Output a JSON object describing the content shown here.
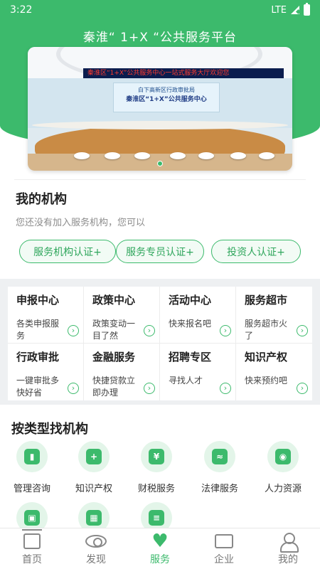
{
  "status_bar": {
    "time": "3:22",
    "network": "LTE"
  },
  "header": {
    "title": "秦淮“ 1+X “公共服务平台"
  },
  "banner": {
    "led_text": "秦淮区“1+X”公共服务中心一站式服务大厅欢迎您",
    "sign_subtitle": "白下高新区行政审批局",
    "sign_title": "秦淮区“1+X”公共服务中心"
  },
  "my_org": {
    "title": "我的机构",
    "hint": "您还没有加入服务机构，您可以",
    "buttons": [
      {
        "label": "服务机构认证+"
      },
      {
        "label": "服务专员认证+"
      },
      {
        "label": "投资人认证+"
      }
    ]
  },
  "services": [
    {
      "title": "申报中心",
      "desc": "各类申报服务"
    },
    {
      "title": "政策中心",
      "desc": "政策变动一目了然"
    },
    {
      "title": "活动中心",
      "desc": "快来报名吧"
    },
    {
      "title": "服务超市",
      "desc": "服务超市火了"
    },
    {
      "title": "行政审批",
      "desc": "一键审批多快好省"
    },
    {
      "title": "金融服务",
      "desc": "快捷贷款立即办理"
    },
    {
      "title": "招聘专区",
      "desc": "寻找人才"
    },
    {
      "title": "知识产权",
      "desc": "快来预约吧"
    }
  ],
  "arrow_glyph": "›",
  "categories": {
    "title": "按类型找机构",
    "items": [
      {
        "label": "管理咨询",
        "icon": "book-icon",
        "glyph": "▮"
      },
      {
        "label": "知识产权",
        "icon": "message-plus-icon",
        "glyph": "+"
      },
      {
        "label": "财税服务",
        "icon": "yen-ticket-icon",
        "glyph": "¥"
      },
      {
        "label": "法律服务",
        "icon": "handshake-icon",
        "glyph": "≈"
      },
      {
        "label": "人力资源",
        "icon": "user-plus-icon",
        "glyph": "◉"
      },
      {
        "label": "",
        "icon": "briefcase-icon",
        "glyph": "▣"
      },
      {
        "label": "",
        "icon": "apps-icon",
        "glyph": "▦"
      },
      {
        "label": "",
        "icon": "list-icon",
        "glyph": "≡"
      }
    ]
  },
  "tabbar": {
    "items": [
      {
        "label": "首页",
        "icon": "home-icon"
      },
      {
        "label": "发现",
        "icon": "eye-icon"
      },
      {
        "label": "服务",
        "icon": "heart-icon"
      },
      {
        "label": "企业",
        "icon": "enterprise-icon"
      },
      {
        "label": "我的",
        "icon": "profile-icon"
      }
    ]
  },
  "colors": {
    "accent": "#3cba6c",
    "background": "#eef0f2"
  }
}
